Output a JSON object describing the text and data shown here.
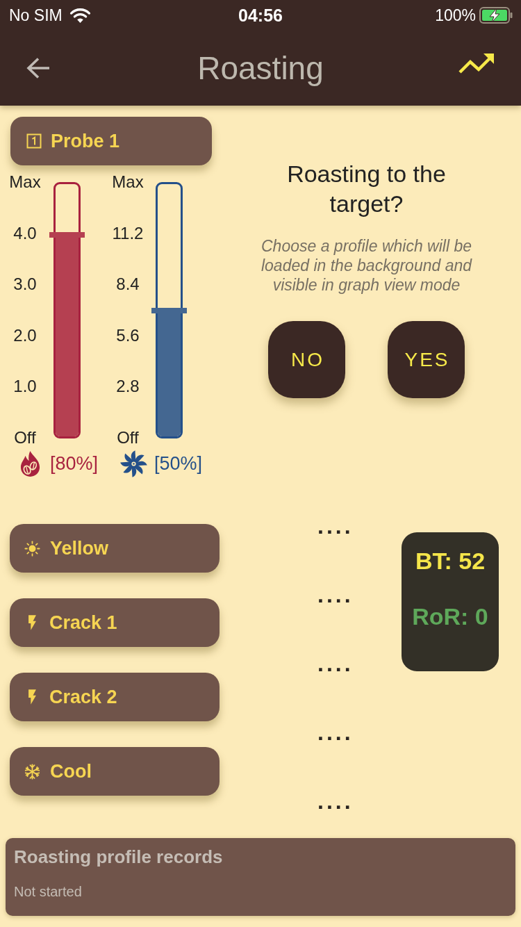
{
  "status_bar": {
    "carrier": "No SIM",
    "time": "04:56",
    "battery": "100%"
  },
  "app_bar": {
    "title": "Roasting"
  },
  "probe_button": {
    "label": "Probe 1"
  },
  "sliders": [
    {
      "kind": "heater",
      "color": "#a8223f",
      "ticks": [
        "Max",
        "4.0",
        "3.0",
        "2.0",
        "1.0",
        "Off"
      ],
      "level": 0.8,
      "reading": "[80%]"
    },
    {
      "kind": "fan",
      "color": "#24508a",
      "ticks": [
        "Max",
        "11.2",
        "8.4",
        "5.6",
        "2.8",
        "Off"
      ],
      "level": 0.5,
      "reading": "[50%]"
    }
  ],
  "prompt": {
    "title": "Roasting to the target?",
    "description": "Choose a profile which will be loaded in the background and visible in graph view mode",
    "buttons": [
      "NO",
      "YES"
    ]
  },
  "events": [
    {
      "kind": "sun",
      "label": "Yellow"
    },
    {
      "kind": "bolt",
      "label": "Crack 1"
    },
    {
      "kind": "bolt",
      "label": "Crack 2"
    },
    {
      "kind": "snowflake",
      "label": "Cool"
    }
  ],
  "markers": [
    "....",
    "....",
    "....",
    "....",
    "...."
  ],
  "readout": {
    "bt": "BT: 52",
    "ror": "RoR: 0"
  },
  "records": {
    "title": "Roasting profile records",
    "status": "Not started"
  }
}
